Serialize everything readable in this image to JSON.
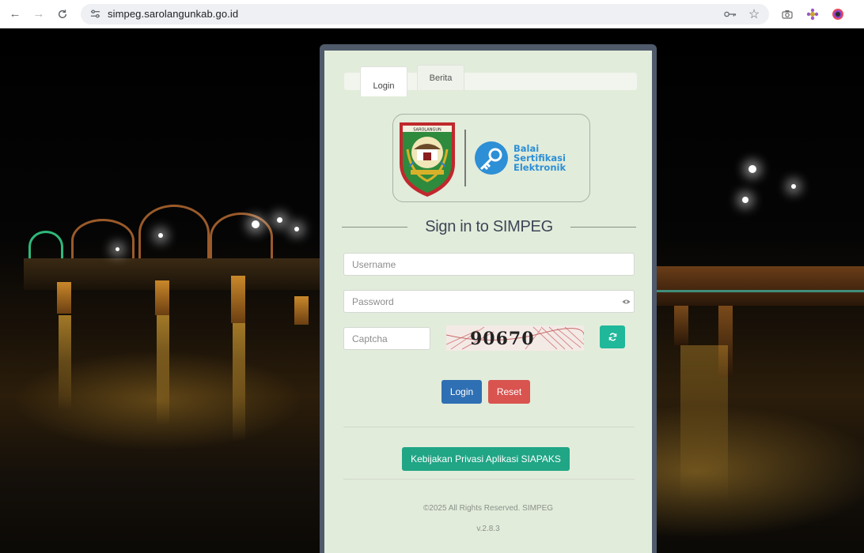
{
  "browser": {
    "url": "simpeg.sarolangunkab.go.id",
    "icons": {
      "back": "arrow-left-icon",
      "forward": "arrow-right-icon",
      "reload": "reload-icon",
      "site_info": "tune-icon",
      "password": "key-icon",
      "bookmark": "star-icon",
      "extensions": [
        "camera-icon",
        "puzzle-flower-icon",
        "profile-ring-icon"
      ]
    }
  },
  "tabs": [
    {
      "label": "Login",
      "active": true
    },
    {
      "label": "Berita",
      "active": false
    }
  ],
  "logo": {
    "crest_banner": "SAROLANGUN",
    "bsre_lines": [
      "Balai",
      "Sertifikasi",
      "Elektronik"
    ],
    "colors": {
      "bsre": "#2d8fd6",
      "crest_red": "#c0282d",
      "crest_green": "#2e8a3c",
      "crest_gold": "#d9b02a"
    }
  },
  "form": {
    "title": "Sign in to SIMPEG",
    "username_placeholder": "Username",
    "password_placeholder": "Password",
    "captcha_placeholder": "Captcha",
    "captcha_code": "90670",
    "login_label": "Login",
    "reset_label": "Reset"
  },
  "policy_label": "Kebijakan Privasi Aplikasi SIAPAKS",
  "footer": {
    "copyright": "©2025 All Rights Reserved. SIMPEG",
    "version": "v.2.8.3"
  },
  "colors": {
    "panel_bg": "#e2ecdb",
    "panel_frame": "#4f5a6b",
    "login_btn": "#2f6fb3",
    "reset_btn": "#d9534f",
    "policy_btn": "#20a585",
    "refresh_btn": "#1fb89a"
  }
}
